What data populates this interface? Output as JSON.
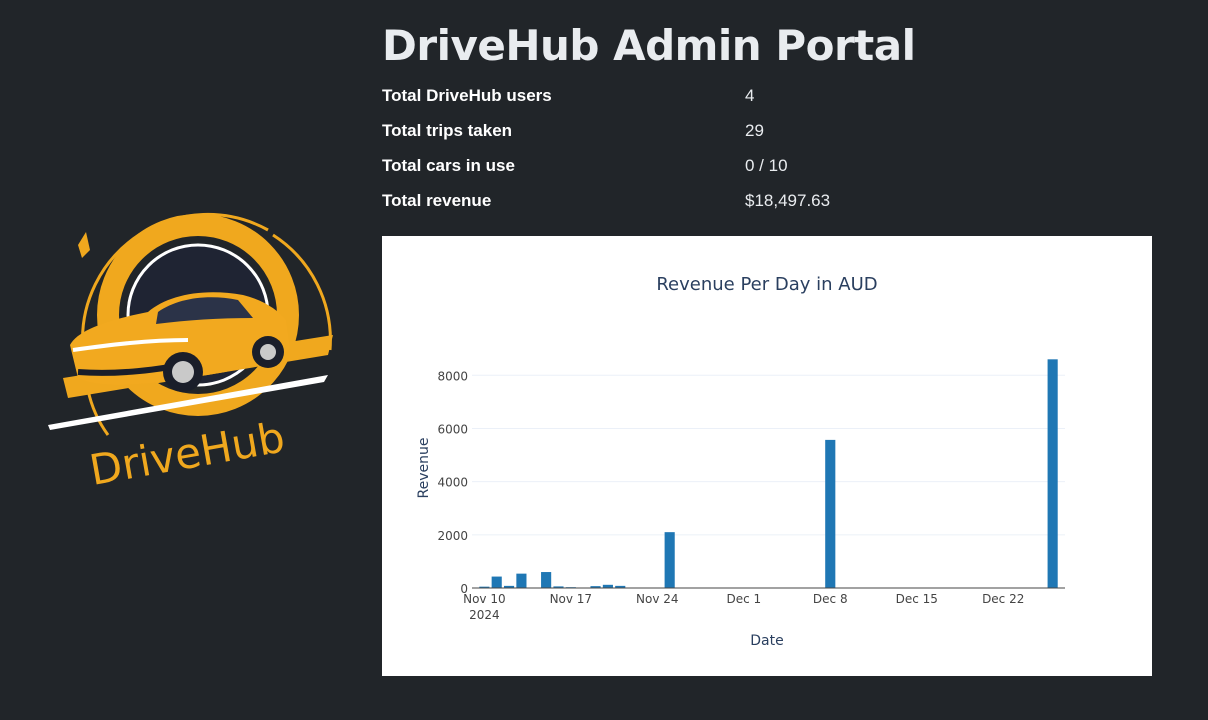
{
  "header": {
    "title": "DriveHub Admin Portal"
  },
  "logo": {
    "text": "DriveHub",
    "icon": "car-logo-icon",
    "accent": "#f0a81e"
  },
  "stats": [
    {
      "label": "Total DriveHub users",
      "value": "4"
    },
    {
      "label": "Total trips taken",
      "value": "29"
    },
    {
      "label": "Total cars in use",
      "value": "0 / 10"
    },
    {
      "label": "Total revenue",
      "value": "$18,497.63"
    }
  ],
  "chart_data": {
    "type": "bar",
    "title": "Revenue Per Day in AUD",
    "xlabel": "Date",
    "ylabel": "Revenue",
    "ylim": [
      0,
      8800
    ],
    "yticks": [
      0,
      2000,
      4000,
      6000,
      8000
    ],
    "xticks": [
      {
        "date": "2024-11-10",
        "label": "Nov 10",
        "sublabel": "2024"
      },
      {
        "date": "2024-11-17",
        "label": "Nov 17"
      },
      {
        "date": "2024-11-24",
        "label": "Nov 24"
      },
      {
        "date": "2024-12-01",
        "label": "Dec 1"
      },
      {
        "date": "2024-12-08",
        "label": "Dec 8"
      },
      {
        "date": "2024-12-15",
        "label": "Dec 15"
      },
      {
        "date": "2024-12-22",
        "label": "Dec 22"
      }
    ],
    "xlim": [
      "2024-11-09",
      "2024-12-27"
    ],
    "grid": true,
    "bar_color": "#1f77b4",
    "series": [
      {
        "x": [
          "2024-11-10",
          "2024-11-11",
          "2024-11-12",
          "2024-11-13",
          "2024-11-15",
          "2024-11-16",
          "2024-11-17",
          "2024-11-19",
          "2024-11-20",
          "2024-11-21",
          "2024-11-25",
          "2024-12-08",
          "2024-12-26"
        ],
        "values": [
          50,
          430,
          80,
          540,
          600,
          60,
          30,
          70,
          120,
          80,
          2100,
          5570,
          8600
        ]
      }
    ]
  }
}
